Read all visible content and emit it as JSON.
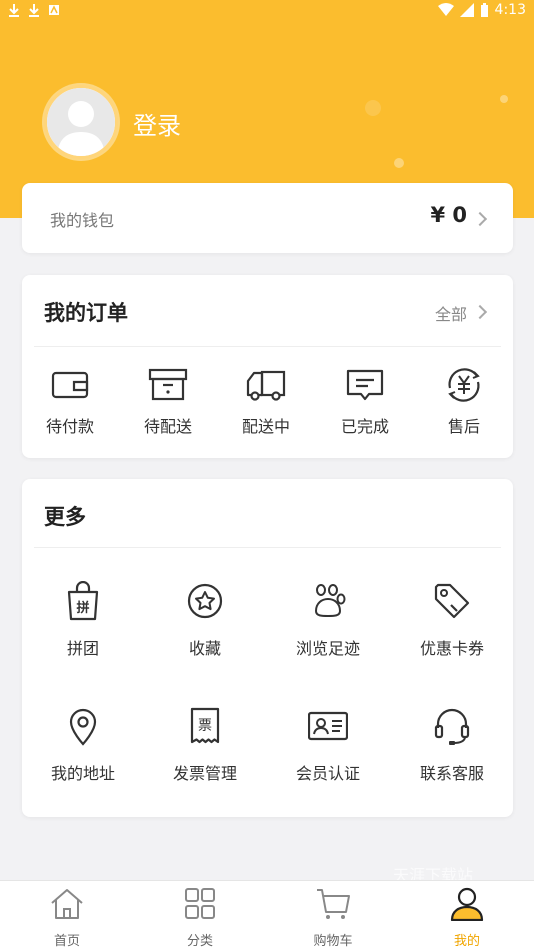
{
  "status_bar": {
    "time": "4:13"
  },
  "profile": {
    "login_label": "登录"
  },
  "wallet": {
    "label": "我的钱包",
    "value": "¥ 0"
  },
  "orders": {
    "title": "我的订单",
    "all_label": "全部",
    "items": [
      {
        "label": "待付款",
        "icon": "wallet-icon"
      },
      {
        "label": "待配送",
        "icon": "archive-box-icon"
      },
      {
        "label": "配送中",
        "icon": "delivery-truck-icon"
      },
      {
        "label": "已完成",
        "icon": "message-box-icon"
      },
      {
        "label": "售后",
        "icon": "refund-yuan-icon"
      }
    ]
  },
  "more": {
    "title": "更多",
    "items": [
      {
        "label": "拼团",
        "icon": "group-buy-bag-icon",
        "icon_text": "拼"
      },
      {
        "label": "收藏",
        "icon": "star-circle-icon"
      },
      {
        "label": "浏览足迹",
        "icon": "paw-print-icon"
      },
      {
        "label": "优惠卡券",
        "icon": "coupon-tag-icon"
      },
      {
        "label": "我的地址",
        "icon": "location-pin-icon"
      },
      {
        "label": "发票管理",
        "icon": "invoice-icon",
        "icon_text": "票"
      },
      {
        "label": "会员认证",
        "icon": "id-card-icon"
      },
      {
        "label": "联系客服",
        "icon": "headset-icon"
      }
    ]
  },
  "watermark": "天涯下载站",
  "tabbar": {
    "items": [
      {
        "label": "首页",
        "icon": "home-icon"
      },
      {
        "label": "分类",
        "icon": "grid-icon"
      },
      {
        "label": "购物车",
        "icon": "cart-icon"
      },
      {
        "label": "我的",
        "icon": "user-icon"
      }
    ]
  },
  "colors": {
    "accent": "#fbbd2e",
    "active_tab": "#f0a500",
    "background": "#f2f2f4"
  }
}
